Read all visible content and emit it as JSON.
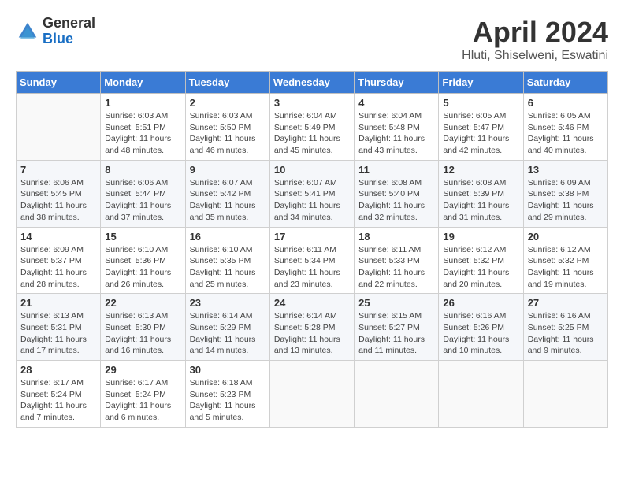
{
  "logo": {
    "general": "General",
    "blue": "Blue"
  },
  "title": "April 2024",
  "location": "Hluti, Shiselweni, Eswatini",
  "days_of_week": [
    "Sunday",
    "Monday",
    "Tuesday",
    "Wednesday",
    "Thursday",
    "Friday",
    "Saturday"
  ],
  "weeks": [
    [
      {
        "day": "",
        "info": ""
      },
      {
        "day": "1",
        "info": "Sunrise: 6:03 AM\nSunset: 5:51 PM\nDaylight: 11 hours\nand 48 minutes."
      },
      {
        "day": "2",
        "info": "Sunrise: 6:03 AM\nSunset: 5:50 PM\nDaylight: 11 hours\nand 46 minutes."
      },
      {
        "day": "3",
        "info": "Sunrise: 6:04 AM\nSunset: 5:49 PM\nDaylight: 11 hours\nand 45 minutes."
      },
      {
        "day": "4",
        "info": "Sunrise: 6:04 AM\nSunset: 5:48 PM\nDaylight: 11 hours\nand 43 minutes."
      },
      {
        "day": "5",
        "info": "Sunrise: 6:05 AM\nSunset: 5:47 PM\nDaylight: 11 hours\nand 42 minutes."
      },
      {
        "day": "6",
        "info": "Sunrise: 6:05 AM\nSunset: 5:46 PM\nDaylight: 11 hours\nand 40 minutes."
      }
    ],
    [
      {
        "day": "7",
        "info": "Sunrise: 6:06 AM\nSunset: 5:45 PM\nDaylight: 11 hours\nand 38 minutes."
      },
      {
        "day": "8",
        "info": "Sunrise: 6:06 AM\nSunset: 5:44 PM\nDaylight: 11 hours\nand 37 minutes."
      },
      {
        "day": "9",
        "info": "Sunrise: 6:07 AM\nSunset: 5:42 PM\nDaylight: 11 hours\nand 35 minutes."
      },
      {
        "day": "10",
        "info": "Sunrise: 6:07 AM\nSunset: 5:41 PM\nDaylight: 11 hours\nand 34 minutes."
      },
      {
        "day": "11",
        "info": "Sunrise: 6:08 AM\nSunset: 5:40 PM\nDaylight: 11 hours\nand 32 minutes."
      },
      {
        "day": "12",
        "info": "Sunrise: 6:08 AM\nSunset: 5:39 PM\nDaylight: 11 hours\nand 31 minutes."
      },
      {
        "day": "13",
        "info": "Sunrise: 6:09 AM\nSunset: 5:38 PM\nDaylight: 11 hours\nand 29 minutes."
      }
    ],
    [
      {
        "day": "14",
        "info": "Sunrise: 6:09 AM\nSunset: 5:37 PM\nDaylight: 11 hours\nand 28 minutes."
      },
      {
        "day": "15",
        "info": "Sunrise: 6:10 AM\nSunset: 5:36 PM\nDaylight: 11 hours\nand 26 minutes."
      },
      {
        "day": "16",
        "info": "Sunrise: 6:10 AM\nSunset: 5:35 PM\nDaylight: 11 hours\nand 25 minutes."
      },
      {
        "day": "17",
        "info": "Sunrise: 6:11 AM\nSunset: 5:34 PM\nDaylight: 11 hours\nand 23 minutes."
      },
      {
        "day": "18",
        "info": "Sunrise: 6:11 AM\nSunset: 5:33 PM\nDaylight: 11 hours\nand 22 minutes."
      },
      {
        "day": "19",
        "info": "Sunrise: 6:12 AM\nSunset: 5:32 PM\nDaylight: 11 hours\nand 20 minutes."
      },
      {
        "day": "20",
        "info": "Sunrise: 6:12 AM\nSunset: 5:32 PM\nDaylight: 11 hours\nand 19 minutes."
      }
    ],
    [
      {
        "day": "21",
        "info": "Sunrise: 6:13 AM\nSunset: 5:31 PM\nDaylight: 11 hours\nand 17 minutes."
      },
      {
        "day": "22",
        "info": "Sunrise: 6:13 AM\nSunset: 5:30 PM\nDaylight: 11 hours\nand 16 minutes."
      },
      {
        "day": "23",
        "info": "Sunrise: 6:14 AM\nSunset: 5:29 PM\nDaylight: 11 hours\nand 14 minutes."
      },
      {
        "day": "24",
        "info": "Sunrise: 6:14 AM\nSunset: 5:28 PM\nDaylight: 11 hours\nand 13 minutes."
      },
      {
        "day": "25",
        "info": "Sunrise: 6:15 AM\nSunset: 5:27 PM\nDaylight: 11 hours\nand 11 minutes."
      },
      {
        "day": "26",
        "info": "Sunrise: 6:16 AM\nSunset: 5:26 PM\nDaylight: 11 hours\nand 10 minutes."
      },
      {
        "day": "27",
        "info": "Sunrise: 6:16 AM\nSunset: 5:25 PM\nDaylight: 11 hours\nand 9 minutes."
      }
    ],
    [
      {
        "day": "28",
        "info": "Sunrise: 6:17 AM\nSunset: 5:24 PM\nDaylight: 11 hours\nand 7 minutes."
      },
      {
        "day": "29",
        "info": "Sunrise: 6:17 AM\nSunset: 5:24 PM\nDaylight: 11 hours\nand 6 minutes."
      },
      {
        "day": "30",
        "info": "Sunrise: 6:18 AM\nSunset: 5:23 PM\nDaylight: 11 hours\nand 5 minutes."
      },
      {
        "day": "",
        "info": ""
      },
      {
        "day": "",
        "info": ""
      },
      {
        "day": "",
        "info": ""
      },
      {
        "day": "",
        "info": ""
      }
    ]
  ]
}
